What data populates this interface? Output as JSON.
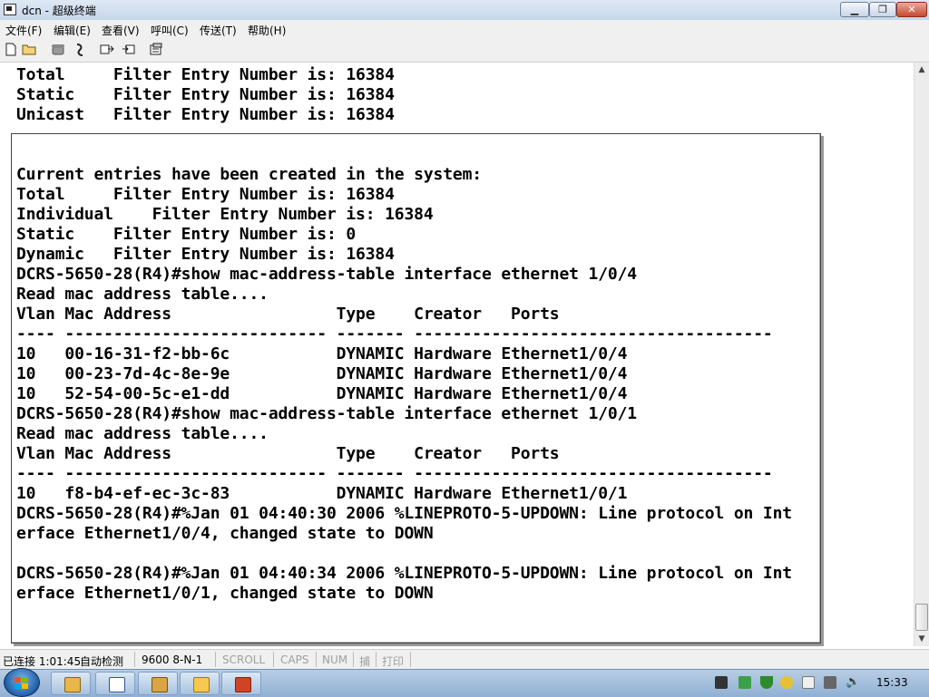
{
  "window": {
    "title": "dcn - 超级终端",
    "controls": [
      "minimize",
      "maximize",
      "close"
    ]
  },
  "menu": [
    "文件(F)",
    "编辑(E)",
    "查看(V)",
    "呼叫(C)",
    "传送(T)",
    "帮助(H)"
  ],
  "toolbar": [
    {
      "name": "new-icon"
    },
    {
      "name": "open-icon"
    },
    {
      "name": "dial-icon"
    },
    {
      "name": "disconnect-icon"
    },
    {
      "name": "send-icon"
    },
    {
      "name": "receive-icon"
    },
    {
      "name": "properties-icon"
    }
  ],
  "terminal": {
    "header_lines": [
      "Total     Filter Entry Number is: 16384",
      "Static    Filter Entry Number is: 16384",
      "Unicast   Filter Entry Number is: 16384"
    ],
    "lines": [
      "",
      "Current entries have been created in the system:",
      "Total     Filter Entry Number is: 16384",
      "Individual    Filter Entry Number is: 16384",
      "Static    Filter Entry Number is: 0",
      "Dynamic   Filter Entry Number is: 16384",
      "DCRS-5650-28(R4)#show mac-address-table interface ethernet 1/0/4",
      "Read mac address table....",
      "Vlan Mac Address                 Type    Creator   Ports",
      "---- --------------------------- ------- -------------------------------------",
      "10   00-16-31-f2-bb-6c           DYNAMIC Hardware Ethernet1/0/4",
      "10   00-23-7d-4c-8e-9e           DYNAMIC Hardware Ethernet1/0/4",
      "10   52-54-00-5c-e1-dd           DYNAMIC Hardware Ethernet1/0/4",
      "DCRS-5650-28(R4)#show mac-address-table interface ethernet 1/0/1",
      "Read mac address table....",
      "Vlan Mac Address                 Type    Creator   Ports",
      "---- --------------------------- ------- -------------------------------------",
      "10   f8-b4-ef-ec-3c-83           DYNAMIC Hardware Ethernet1/0/1",
      "DCRS-5650-28(R4)#%Jan 01 04:40:30 2006 %LINEPROTO-5-UPDOWN: Line protocol on Int",
      "erface Ethernet1/0/4, changed state to DOWN",
      "",
      "DCRS-5650-28(R4)#%Jan 01 04:40:34 2006 %LINEPROTO-5-UPDOWN: Line protocol on Int",
      "erface Ethernet1/0/1, changed state to DOWN"
    ]
  },
  "status": {
    "connected": "已连接 1:01:45",
    "detect": "自动检测",
    "baud": "9600 8-N-1",
    "scroll": "SCROLL",
    "caps": "CAPS",
    "num": "NUM",
    "capture": "捕",
    "print": "打印"
  },
  "taskbar": {
    "apps": [
      "explorer",
      "word",
      "folder",
      "paint",
      "powerpoint"
    ],
    "clock": "15:33"
  }
}
